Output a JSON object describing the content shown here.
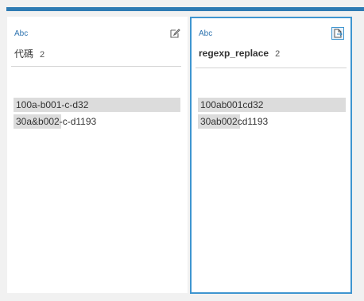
{
  "columns": [
    {
      "type_label": "Abc",
      "title": "代碼",
      "count": "2",
      "action_icon": "edit-icon",
      "values": [
        {
          "text": "100a-b001-c-d32",
          "bar": "full"
        },
        {
          "text": "30a&b002-c-d1193",
          "bar": "partial"
        }
      ]
    },
    {
      "type_label": "Abc",
      "title": "regexp_replace",
      "count": "2",
      "action_icon": "document-icon",
      "selected": true,
      "values": [
        {
          "text": "100ab001cd32",
          "bar": "full"
        },
        {
          "text": "30ab002cd1193",
          "bar": "partial"
        }
      ]
    }
  ],
  "colors": {
    "accent": "#2e7bb3",
    "selected_border": "#3e95d0",
    "value_bar": "#dcdcdc",
    "background": "#f1f1f1"
  }
}
